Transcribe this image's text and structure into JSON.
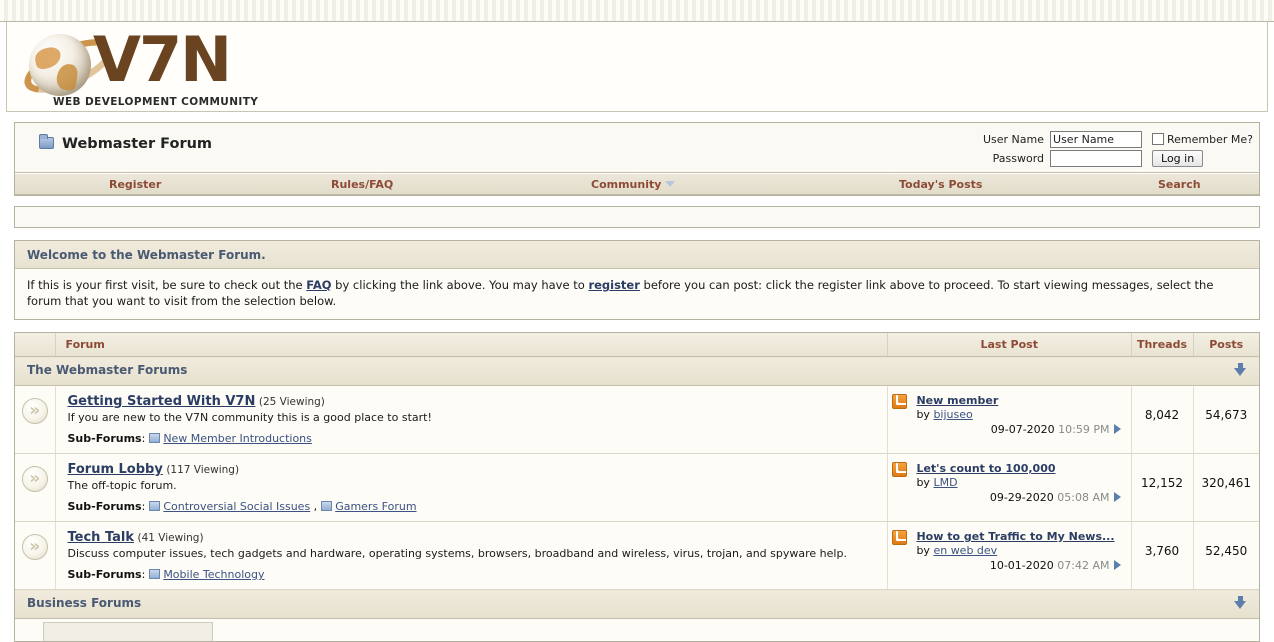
{
  "site": {
    "logo_text": "V7N",
    "logo_tagline": "WEB DEVELOPMENT COMMUNITY"
  },
  "header": {
    "forum_title": "Webmaster Forum",
    "folder_icon": "folder-icon"
  },
  "login": {
    "username_label": "User Name",
    "username_value": "User Name",
    "password_label": "Password",
    "password_value": "",
    "remember_label": "Remember Me?",
    "login_button": "Log in"
  },
  "nav": {
    "items": [
      {
        "label": "Register",
        "has_chevron": false
      },
      {
        "label": "Rules/FAQ",
        "has_chevron": false
      },
      {
        "label": "Community",
        "has_chevron": true
      },
      {
        "label": "Today's Posts",
        "has_chevron": false
      },
      {
        "label": "Search",
        "has_chevron": false
      }
    ]
  },
  "welcome": {
    "heading": "Welcome to the Webmaster Forum.",
    "body_part1": "If this is your first visit, be sure to check out the ",
    "faq_link": "FAQ",
    "body_part2": " by clicking the link above. You may have to ",
    "register_link": "register",
    "body_part3": " before you can post: click the register link above to proceed. To start viewing messages, select the forum that you want to visit from the selection below."
  },
  "table": {
    "headers": {
      "forum": "Forum",
      "last_post": "Last Post",
      "threads": "Threads",
      "posts": "Posts"
    },
    "categories": [
      {
        "title": "The Webmaster Forums",
        "collapse_icon": "down-arrow-icon",
        "forums": [
          {
            "name": "Getting Started With V7N",
            "viewing": "(25 Viewing)",
            "description": "If you are new to the V7N community this is a good place to start!",
            "subforums_label": "Sub-Forums",
            "subforums": [
              "New Member Introductions"
            ],
            "last_post": {
              "thread": "New member",
              "by_label": "by",
              "user": "bijuseo",
              "date": "09-07-2020",
              "time": "10:59 PM"
            },
            "threads": "8,042",
            "posts": "54,673"
          },
          {
            "name": "Forum Lobby",
            "viewing": "(117 Viewing)",
            "description": "The off-topic forum.",
            "subforums_label": "Sub-Forums",
            "subforums": [
              "Controversial Social Issues",
              "Gamers Forum"
            ],
            "last_post": {
              "thread": "Let's count to 100,000",
              "by_label": "by",
              "user": "LMD",
              "date": "09-29-2020",
              "time": "05:08 AM"
            },
            "threads": "12,152",
            "posts": "320,461"
          },
          {
            "name": "Tech Talk",
            "viewing": "(41 Viewing)",
            "description": "Discuss computer issues, tech gadgets and hardware, operating systems, browsers, broadband and wireless, virus, trojan, and spyware help.",
            "subforums_label": "Sub-Forums",
            "subforums": [
              "Mobile Technology"
            ],
            "last_post": {
              "thread": "How to get Traffic to My News...",
              "by_label": "by",
              "user": "en web dev",
              "date": "10-01-2020",
              "time": "07:42 AM"
            },
            "threads": "3,760",
            "posts": "52,450"
          }
        ]
      },
      {
        "title": "Business Forums",
        "collapse_icon": "down-arrow-icon",
        "forums": []
      }
    ]
  },
  "colors": {
    "nav_link": "#8d4b36",
    "category_title": "#4a5a73",
    "forum_link": "#2b3d63",
    "rss_orange": "#e07b17",
    "panel_bg": "#faf8f2"
  }
}
